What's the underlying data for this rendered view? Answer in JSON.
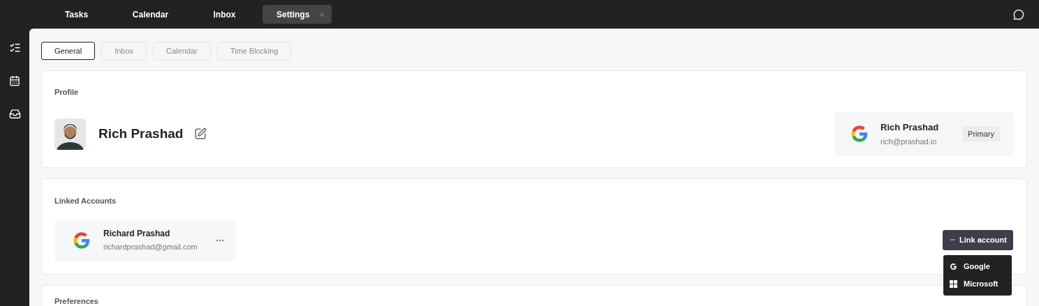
{
  "top_tabs": [
    {
      "label": "Tasks",
      "selected": false
    },
    {
      "label": "Calendar",
      "selected": false
    },
    {
      "label": "Inbox",
      "selected": false
    },
    {
      "label": "Settings",
      "selected": true
    }
  ],
  "settings_tabs": [
    {
      "label": "General",
      "selected": true
    },
    {
      "label": "Inbox",
      "selected": false
    },
    {
      "label": "Calendar",
      "selected": false
    },
    {
      "label": "Time Blocking",
      "selected": false
    }
  ],
  "profile": {
    "title": "Profile",
    "name": "Rich Prashad",
    "account": {
      "name": "Rich Prashad",
      "email": "rich@prashad.io",
      "badge": "Primary"
    }
  },
  "linked_accounts": {
    "title": "Linked Accounts",
    "accounts": [
      {
        "name": "Richard Prashad",
        "email": "richardprashad@gmail.com"
      }
    ],
    "link_button": "Link account",
    "expanded": true,
    "menu": [
      {
        "label": "Google",
        "kind": "google"
      },
      {
        "label": "Microsoft",
        "kind": "microsoft"
      }
    ]
  },
  "preferences": {
    "title": "Preferences"
  }
}
